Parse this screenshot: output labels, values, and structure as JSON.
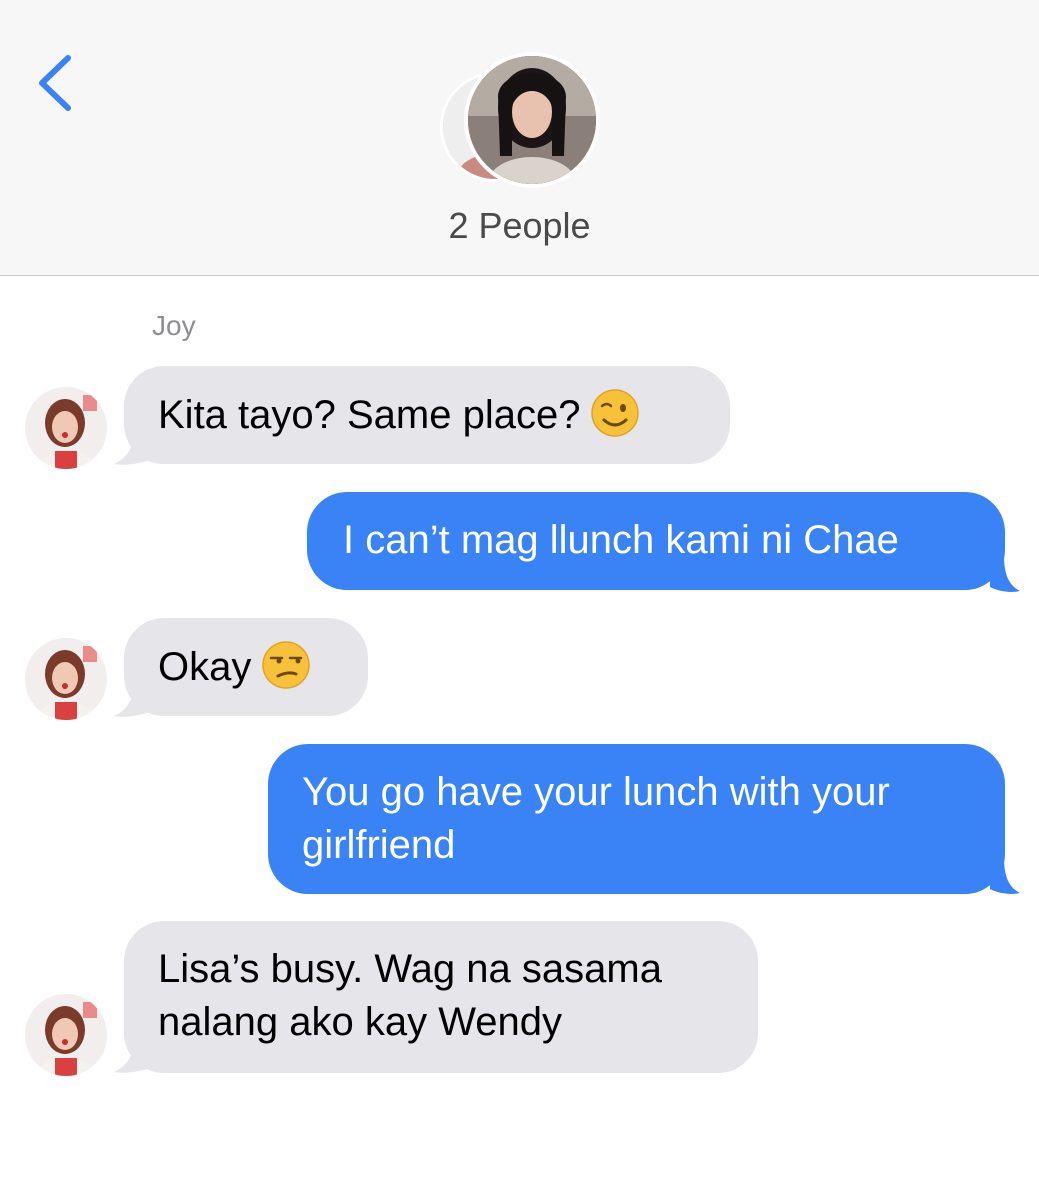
{
  "header": {
    "back_icon": "chevron-left-icon",
    "people_label": "2 People"
  },
  "conversation": {
    "sender_name": "Joy",
    "messages": [
      {
        "direction": "incoming",
        "text": "Kita tayo? Same place?",
        "emoji": "winking-face"
      },
      {
        "direction": "outgoing",
        "text": "I can’t mag llunch kami ni Chae"
      },
      {
        "direction": "incoming",
        "text": "Okay",
        "emoji": "unamused-face"
      },
      {
        "direction": "outgoing",
        "line1": "You go have your lunch with your",
        "line2": "girlfriend"
      },
      {
        "direction": "incoming",
        "line1": "Lisa’s busy. Wag na sasama",
        "line2": "nalang ako kay Wendy"
      }
    ]
  },
  "colors": {
    "accent": "#3a83f7",
    "incoming_bubble": "#e5e5ea",
    "header_bg": "#f7f7f7",
    "secondary_text": "#8e8e93"
  }
}
